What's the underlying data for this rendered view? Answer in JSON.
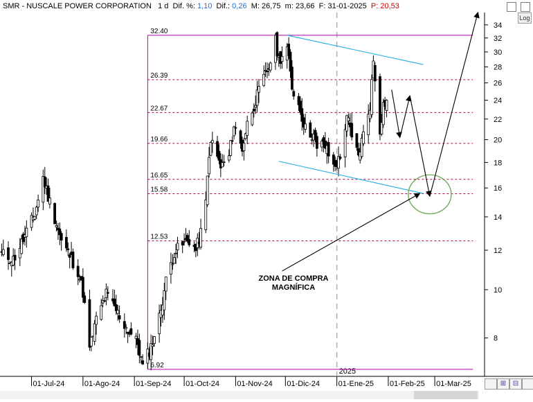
{
  "header": {
    "symbol": "SMR - NUSCALE POWER CORPORATION",
    "timeframe": "1 d",
    "dif_pct_label": "Dif. %:",
    "dif_pct_value": "1,10",
    "dif_label": "Dif.:",
    "dif_value": "0,26",
    "max_label": "M:",
    "max_value": "26,75",
    "min_label": "m:",
    "min_value": "23,66",
    "date_label": "F:",
    "date_value": "31-01-2025",
    "close_label": "P:",
    "close_value": "20,53"
  },
  "controls": {
    "log_label": "Log",
    "zoom_label": "",
    "nav_first": "⊞",
    "nav_second": "⊟"
  },
  "annotation": {
    "line1": "ZONA DE COMPRA",
    "line2": "MAGNÍFICA",
    "year_marker": "2025"
  },
  "colors": {
    "candle": "#000000",
    "fib_frame": "#b000b0",
    "fib_level": "#c0004a",
    "channel": "#35b5e0",
    "zone_circle": "#6aa84f",
    "projection": "#000000",
    "year_divider": "#b0b0b0"
  },
  "chart_data": {
    "type": "candlestick",
    "scale": "log",
    "ylim": [
      6.7,
      36
    ],
    "y_ticks": [
      8,
      10,
      12,
      14,
      16,
      18,
      20,
      22,
      24,
      26,
      28,
      30,
      32,
      34
    ],
    "x_tick_labels": [
      "01-Jul-24",
      "01-Ago-24",
      "01-Sep-24",
      "01-Oct-24",
      "01-Nov-24",
      "01-Dic-24",
      "01-Ene-25",
      "01-Feb-25",
      "01-Mar-25"
    ],
    "x_tick_dates": [
      "2024-07-01",
      "2024-08-01",
      "2024-09-01",
      "2024-10-01",
      "2024-11-01",
      "2024-12-01",
      "2025-01-01",
      "2025-02-01",
      "2025-03-01"
    ],
    "x_range": [
      "2024-06-12",
      "2025-03-31"
    ],
    "price_path": [
      [
        "2024-06-13",
        11.8
      ],
      [
        "2024-06-20",
        11.5
      ],
      [
        "2024-06-27",
        12.8
      ],
      [
        "2024-07-03",
        14.2
      ],
      [
        "2024-07-08",
        16.8
      ],
      [
        "2024-07-11",
        15.4
      ],
      [
        "2024-07-16",
        13.6
      ],
      [
        "2024-07-19",
        12.5
      ],
      [
        "2024-07-24",
        11.7
      ],
      [
        "2024-07-29",
        10.9
      ],
      [
        "2024-08-01",
        9.9
      ],
      [
        "2024-08-05",
        7.6
      ],
      [
        "2024-08-09",
        8.7
      ],
      [
        "2024-08-15",
        9.8
      ],
      [
        "2024-08-20",
        9.2
      ],
      [
        "2024-08-27",
        8.4
      ],
      [
        "2024-09-03",
        7.8
      ],
      [
        "2024-09-06",
        7.0
      ],
      [
        "2024-09-11",
        7.7
      ],
      [
        "2024-09-16",
        8.8
      ],
      [
        "2024-09-20",
        10.4
      ],
      [
        "2024-09-25",
        11.9
      ],
      [
        "2024-09-30",
        12.3
      ],
      [
        "2024-10-04",
        12.6
      ],
      [
        "2024-10-08",
        12.0
      ],
      [
        "2024-10-11",
        13.0
      ],
      [
        "2024-10-14",
        14.9
      ],
      [
        "2024-10-16",
        18.9
      ],
      [
        "2024-10-18",
        19.8
      ],
      [
        "2024-10-23",
        17.6
      ],
      [
        "2024-10-28",
        18.5
      ],
      [
        "2024-10-31",
        21.4
      ],
      [
        "2024-11-05",
        19.2
      ],
      [
        "2024-11-08",
        21.5
      ],
      [
        "2024-11-13",
        24.0
      ],
      [
        "2024-11-18",
        26.5
      ],
      [
        "2024-11-21",
        28.0
      ],
      [
        "2024-11-25",
        31.5
      ],
      [
        "2024-11-27",
        29.0
      ],
      [
        "2024-12-02",
        30.5
      ],
      [
        "2024-12-05",
        25.5
      ],
      [
        "2024-12-10",
        23.0
      ],
      [
        "2024-12-13",
        21.0
      ],
      [
        "2024-12-18",
        20.4
      ],
      [
        "2024-12-20",
        19.0
      ],
      [
        "2024-12-24",
        19.7
      ],
      [
        "2024-12-30",
        17.7
      ],
      [
        "2025-01-03",
        18.3
      ],
      [
        "2025-01-07",
        22.5
      ],
      [
        "2025-01-10",
        20.0
      ],
      [
        "2025-01-14",
        18.6
      ],
      [
        "2025-01-17",
        20.5
      ],
      [
        "2025-01-21",
        23.5
      ],
      [
        "2025-01-23",
        28.8
      ],
      [
        "2025-01-27",
        21.0
      ],
      [
        "2025-01-29",
        23.5
      ],
      [
        "2025-01-31",
        24.0
      ]
    ],
    "fibonacci": {
      "low": 6.92,
      "high": 32.4,
      "levels": [
        32.4,
        26.39,
        22.67,
        19.66,
        16.65,
        15.58,
        12.53,
        6.92
      ],
      "level_labels": [
        "32.40",
        "26.39",
        "22.67",
        "19.66",
        "16.65",
        "15.58",
        "12.53",
        "6.92"
      ],
      "start_date": "2024-09-09",
      "end_date": "2025-03-24"
    },
    "channel_lines": [
      {
        "from": [
          "2024-12-02",
          32.4
        ],
        "to": [
          "2025-02-22",
          28.3
        ]
      },
      {
        "from": [
          "2024-11-27",
          18.1
        ],
        "to": [
          "2025-02-22",
          15.6
        ]
      }
    ],
    "projection_path": [
      [
        "2025-02-03",
        25.2
      ],
      [
        "2025-02-08",
        20.2
      ],
      [
        "2025-02-14",
        24.5
      ],
      [
        "2025-02-26",
        15.4
      ],
      [
        "2025-03-27",
        36.0
      ]
    ],
    "buy_zone": {
      "center": [
        "2025-02-26",
        15.6
      ],
      "low": 14.2,
      "high": 17.0
    },
    "pointer_arrow": {
      "from": [
        "2024-11-29",
        10.9
      ],
      "to": [
        "2025-02-20",
        15.6
      ]
    },
    "year_divider_date": "2025-01-01"
  }
}
